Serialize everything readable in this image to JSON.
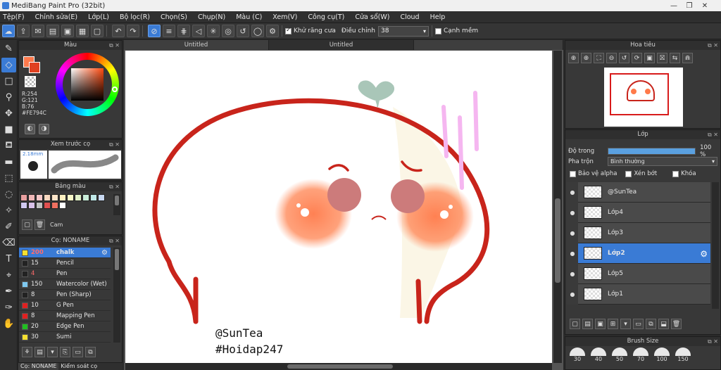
{
  "window": {
    "title": "MediBang Paint Pro (32bit)",
    "controls": [
      "—",
      "❐",
      "✕"
    ]
  },
  "menu": [
    "Tệp(F)",
    "Chỉnh sửa(E)",
    "Lớp(L)",
    "Bộ lọc(R)",
    "Chọn(S)",
    "Chụp(N)",
    "Màu (C)",
    "Xem(V)",
    "Công cụ(T)",
    "Cửa sổ(W)",
    "Cloud",
    "Help"
  ],
  "toolbar": {
    "antialias_label": "Khử răng cưa",
    "adjust_label": "Điều chỉnh",
    "adjust_value": "38",
    "sharp_label": "Cạnh mềm"
  },
  "color_panel": {
    "title": "Màu",
    "r": "R:254",
    "g": "G:121",
    "b": "B:76",
    "hex": "#FE794C",
    "fg_color": "#FE794C"
  },
  "brush_preview": {
    "title": "Xem trước cọ",
    "size": "2.18mm"
  },
  "palette": {
    "title": "Bảng màu",
    "name": "Cam",
    "swatches": [
      "#e8a0a0",
      "#f0b8b8",
      "#f5c8c8",
      "#f8d8c0",
      "#fbe4c8",
      "#fff0c0",
      "#f8f8c8",
      "#e0f0c8",
      "#c8ecd8",
      "#c0e8e8",
      "#c8d8f0",
      "#d0c8f0",
      "#d8c0e8",
      "#c0c0c0",
      "#e05050",
      "#f07060",
      "#ffffff"
    ]
  },
  "brushes": {
    "title": "Cọ: NONAME",
    "items": [
      {
        "size": "200",
        "name": "chalk",
        "color": "#f5e030"
      },
      {
        "size": "15",
        "name": "Pencil",
        "color": "#222222"
      },
      {
        "size": "4",
        "name": "Pen",
        "color": "#222222"
      },
      {
        "size": "150",
        "name": "Watercolor (Wet)",
        "color": "#7ec8f0"
      },
      {
        "size": "8",
        "name": "Pen (Sharp)",
        "color": "#222222"
      },
      {
        "size": "10",
        "name": "G Pen",
        "color": "#e02020"
      },
      {
        "size": "8",
        "name": "Mapping Pen",
        "color": "#e02020"
      },
      {
        "size": "20",
        "name": "Edge Pen",
        "color": "#20c020"
      },
      {
        "size": "30",
        "name": "Sumi",
        "color": "#f5e030"
      }
    ]
  },
  "bottom_tabs": [
    "Cọ: NONAME",
    "Kiểm soát cọ"
  ],
  "doc_tabs": [
    "Untitled",
    "Untitled"
  ],
  "canvas_text": {
    "line1": "@SunTea",
    "line2": "#Hoidap247"
  },
  "navigator": {
    "title": "Hoa tiêu"
  },
  "layers": {
    "title": "Lớp",
    "opacity_label": "Độ trong",
    "opacity_value": "100 %",
    "opacity": 1.0,
    "blend_label": "Pha trộn",
    "blend_value": "Bình thường",
    "protect_alpha": "Bảo vệ alpha",
    "clip": "Xén bớt",
    "lock": "Khóa",
    "items": [
      {
        "name": "@SunTea",
        "selected": false
      },
      {
        "name": "Lớp4",
        "selected": false
      },
      {
        "name": "Lớp3",
        "selected": false
      },
      {
        "name": "Lớp2",
        "selected": true
      },
      {
        "name": "Lớp5",
        "selected": false
      },
      {
        "name": "Lớp1",
        "selected": false
      }
    ]
  },
  "brush_size": {
    "title": "Brush Size",
    "sizes": [
      "30",
      "40",
      "50",
      "70",
      "100",
      "150"
    ]
  }
}
